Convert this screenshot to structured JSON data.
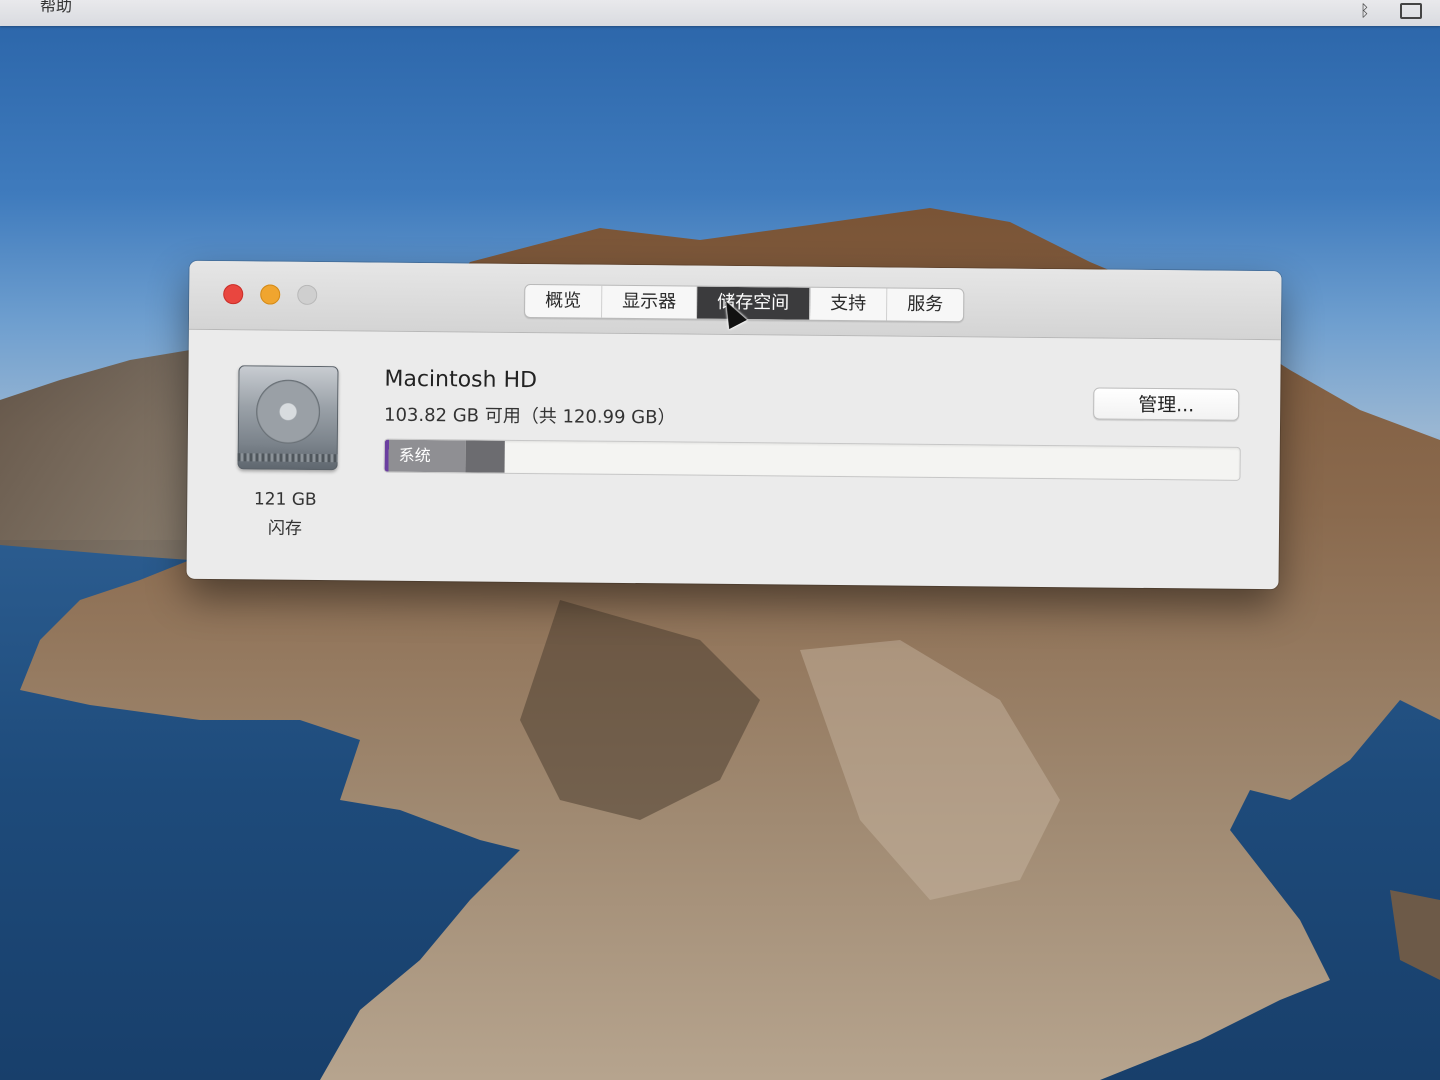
{
  "menubar": {
    "help_label": "帮助"
  },
  "window": {
    "tabs": [
      {
        "label": "概览",
        "active": false
      },
      {
        "label": "显示器",
        "active": false
      },
      {
        "label": "储存空间",
        "active": true
      },
      {
        "label": "支持",
        "active": false
      },
      {
        "label": "服务",
        "active": false
      }
    ],
    "disk": {
      "size": "121 GB",
      "type": "闪存"
    },
    "volume": {
      "name": "Macintosh HD",
      "availability": "103.82 GB 可用（共 120.99 GB）",
      "manage_label": "管理..."
    },
    "storage_bar": {
      "total_gb": 120.99,
      "available_gb": 103.82,
      "segments": [
        {
          "label": "系统",
          "fraction": 0.095,
          "color": "#8f8f93"
        },
        {
          "label": "",
          "fraction": 0.045,
          "color": "#6c6c70"
        }
      ]
    }
  },
  "colors": {
    "close": "#e9463f",
    "minimize": "#f0a52f",
    "zoom": "#cfcfcf",
    "active_tab": "#3b3b3d",
    "system_segment_accent": "#6b3fa0"
  }
}
